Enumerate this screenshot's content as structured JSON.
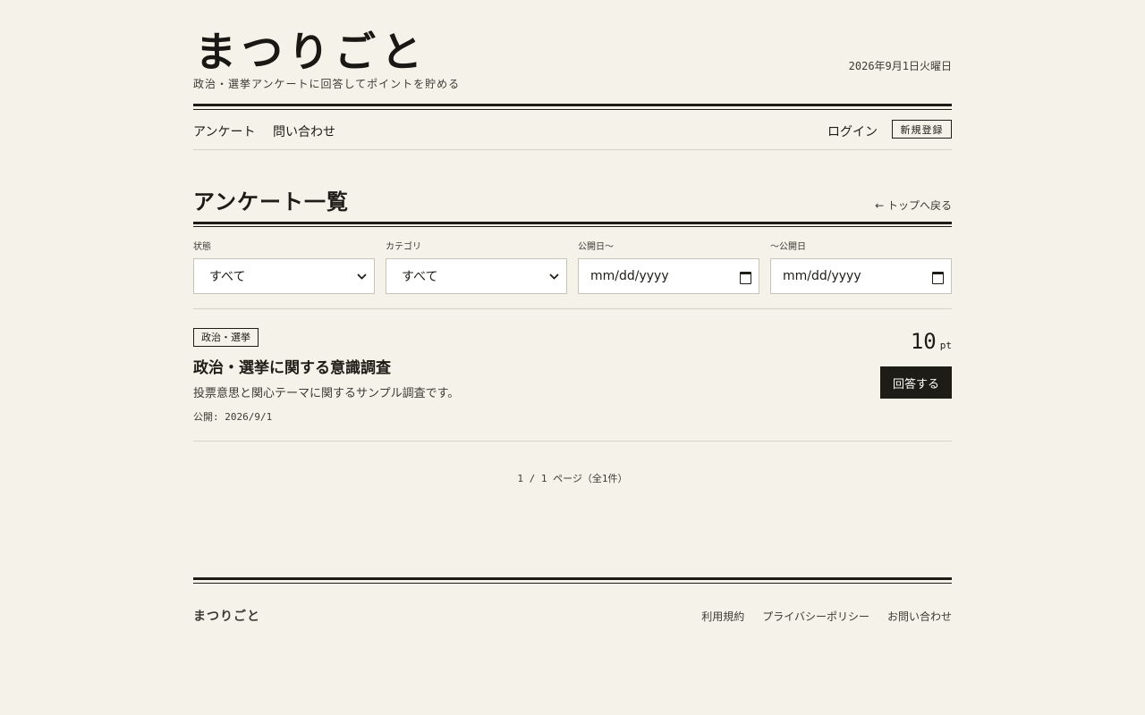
{
  "header": {
    "site_title": "まつりごと",
    "tagline": "政治・選挙アンケートに回答してポイントを貯める",
    "date": "2026年9月1日火曜日"
  },
  "nav": {
    "surveys": "アンケート",
    "contact": "問い合わせ",
    "login": "ログイン",
    "register": "新規登録"
  },
  "page": {
    "title": "アンケート一覧",
    "back_link": "← トップへ戻る"
  },
  "filters": {
    "status": {
      "label": "状態",
      "value": "すべて"
    },
    "category": {
      "label": "カテゴリ",
      "value": "すべて"
    },
    "date_from": {
      "label": "公開日〜",
      "placeholder": "mm/dd/yyyy"
    },
    "date_to": {
      "label": "〜公開日",
      "placeholder": "mm/dd/yyyy"
    }
  },
  "surveys": [
    {
      "tag": "政治・選挙",
      "title": "政治・選挙に関する意識調査",
      "description": "投票意思と関心テーマに関するサンプル調査です。",
      "published": "公開: 2026/9/1",
      "points": "10",
      "points_unit": "pt",
      "answer_label": "回答する"
    }
  ],
  "pagination": {
    "text": "1 / 1 ページ（全1件）"
  },
  "footer": {
    "logo": "まつりごと",
    "links": [
      "利用規約",
      "プライバシーポリシー",
      "お問い合わせ"
    ]
  }
}
